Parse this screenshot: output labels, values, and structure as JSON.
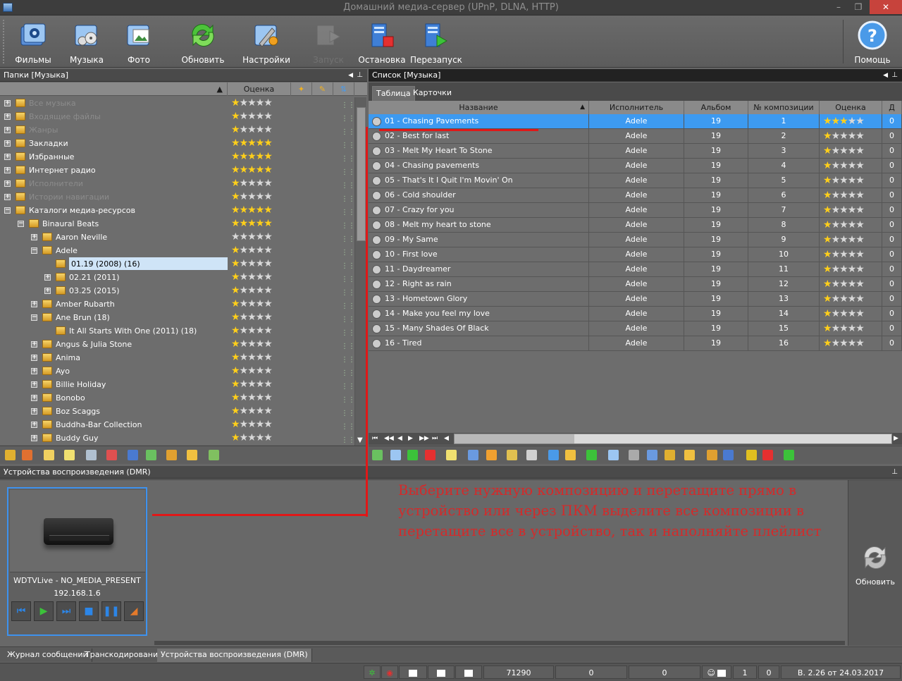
{
  "window": {
    "title": "Домашний медиа-сервер (UPnP, DLNA, HTTP)"
  },
  "toolbar": {
    "buttons": [
      {
        "label": "Фильмы"
      },
      {
        "label": "Музыка"
      },
      {
        "label": "Фото"
      },
      {
        "label": "Обновить"
      },
      {
        "label": "Настройки"
      },
      {
        "label": "Запуск",
        "disabled": true
      },
      {
        "label": "Остановка"
      },
      {
        "label": "Перезапуск"
      }
    ],
    "help_label": "Помощь"
  },
  "left_panel": {
    "title": "Папки [Музыка]",
    "column_rating": "Оценка",
    "tree": [
      {
        "label": "Все музыка",
        "dim": true,
        "rating": 1,
        "level": 0,
        "exp": "+"
      },
      {
        "label": "Входящие файлы",
        "dim": true,
        "rating": 1,
        "level": 0,
        "exp": "+"
      },
      {
        "label": "Жанры",
        "dim": true,
        "rating": 1,
        "level": 0,
        "exp": "+"
      },
      {
        "label": "Закладки",
        "rating": 5,
        "level": 0,
        "exp": "+"
      },
      {
        "label": "Избранные",
        "rating": 5,
        "level": 0,
        "exp": "+"
      },
      {
        "label": "Интернет радио",
        "rating": 5,
        "level": 0,
        "exp": "+"
      },
      {
        "label": "Исполнители",
        "dim": true,
        "rating": 1,
        "level": 0,
        "exp": "+"
      },
      {
        "label": "Истории навигации",
        "dim": true,
        "rating": 1,
        "level": 0,
        "exp": "+"
      },
      {
        "label": "Каталоги медиа-ресурсов",
        "rating": 5,
        "level": 0,
        "exp": "−"
      },
      {
        "label": "Binaural Beats",
        "rating": 5,
        "level": 1,
        "exp": "−"
      },
      {
        "label": "Aaron Neville",
        "rating": 0,
        "level": 2,
        "exp": "+"
      },
      {
        "label": "Adele",
        "rating": 1,
        "level": 2,
        "exp": "−"
      },
      {
        "label": "01.19 (2008) (16)",
        "rating": 1,
        "level": 3,
        "exp": "",
        "selected": true
      },
      {
        "label": "02.21 (2011)",
        "rating": 1,
        "level": 3,
        "exp": "+"
      },
      {
        "label": "03.25 (2015)",
        "rating": 1,
        "level": 3,
        "exp": "+"
      },
      {
        "label": "Amber Rubarth",
        "rating": 1,
        "level": 2,
        "exp": "+"
      },
      {
        "label": "Ane Brun (18)",
        "rating": 1,
        "level": 2,
        "exp": "−"
      },
      {
        "label": "It All Starts With One (2011) (18)",
        "rating": 1,
        "level": 3,
        "exp": ""
      },
      {
        "label": "Angus & Julia Stone",
        "rating": 1,
        "level": 2,
        "exp": "+"
      },
      {
        "label": "Anima",
        "rating": 1,
        "level": 2,
        "exp": "+"
      },
      {
        "label": "Ayo",
        "rating": 1,
        "level": 2,
        "exp": "+"
      },
      {
        "label": "Billie Holiday",
        "rating": 1,
        "level": 2,
        "exp": "+"
      },
      {
        "label": "Bonobo",
        "rating": 1,
        "level": 2,
        "exp": "+"
      },
      {
        "label": "Boz Scaggs",
        "rating": 1,
        "level": 2,
        "exp": "+"
      },
      {
        "label": "Buddha-Bar Collection",
        "rating": 1,
        "level": 2,
        "exp": "+"
      },
      {
        "label": "Buddy Guy",
        "rating": 1,
        "level": 2,
        "exp": "+"
      }
    ]
  },
  "right_panel": {
    "title": "Список [Музыка]",
    "tabs": [
      "Таблица",
      "Карточки"
    ],
    "columns": [
      "Название",
      "Исполнитель",
      "Альбом",
      "№ композиции",
      "Оценка",
      "Д"
    ],
    "rows": [
      {
        "name": "01 - Chasing Pavements",
        "artist": "Adele",
        "album": "19",
        "num": "1",
        "rating": 3,
        "d": "0"
      },
      {
        "name": "02 - Best for last",
        "artist": "Adele",
        "album": "19",
        "num": "2",
        "rating": 1,
        "d": "0"
      },
      {
        "name": "03 - Melt My Heart To Stone",
        "artist": "Adele",
        "album": "19",
        "num": "3",
        "rating": 1,
        "d": "0"
      },
      {
        "name": "04 - Chasing pavements",
        "artist": "Adele",
        "album": "19",
        "num": "4",
        "rating": 1,
        "d": "0"
      },
      {
        "name": "05 - That's It I Quit I'm Movin' On",
        "artist": "Adele",
        "album": "19",
        "num": "5",
        "rating": 1,
        "d": "0"
      },
      {
        "name": "06 - Cold shoulder",
        "artist": "Adele",
        "album": "19",
        "num": "6",
        "rating": 1,
        "d": "0"
      },
      {
        "name": "07 - Crazy for you",
        "artist": "Adele",
        "album": "19",
        "num": "7",
        "rating": 1,
        "d": "0"
      },
      {
        "name": "08 - Melt my heart to stone",
        "artist": "Adele",
        "album": "19",
        "num": "8",
        "rating": 1,
        "d": "0"
      },
      {
        "name": "09 - My Same",
        "artist": "Adele",
        "album": "19",
        "num": "9",
        "rating": 1,
        "d": "0"
      },
      {
        "name": "10 - First love",
        "artist": "Adele",
        "album": "19",
        "num": "10",
        "rating": 1,
        "d": "0"
      },
      {
        "name": "11 - Daydreamer",
        "artist": "Adele",
        "album": "19",
        "num": "11",
        "rating": 1,
        "d": "0"
      },
      {
        "name": "12 - Right as rain",
        "artist": "Adele",
        "album": "19",
        "num": "12",
        "rating": 1,
        "d": "0"
      },
      {
        "name": "13 - Hometown Glory",
        "artist": "Adele",
        "album": "19",
        "num": "13",
        "rating": 1,
        "d": "0"
      },
      {
        "name": "14 - Make you feel my love",
        "artist": "Adele",
        "album": "19",
        "num": "14",
        "rating": 1,
        "d": "0"
      },
      {
        "name": "15 - Many Shades Of Black",
        "artist": "Adele",
        "album": "19",
        "num": "15",
        "rating": 1,
        "d": "0"
      },
      {
        "name": "16 - Tired",
        "artist": "Adele",
        "album": "19",
        "num": "16",
        "rating": 1,
        "d": "0"
      }
    ]
  },
  "devices": {
    "title": "Устройства воспроизведения (DMR)",
    "device_name": "WDTVLive - NO_MEDIA_PRESENT",
    "device_ip": "192.168.1.6",
    "hint": "Выберите нужную композицию и перетащите прямо в устройство или через ПКМ выделите все композиции в перетащите все в устройство, так и наполняйте плейлист",
    "refresh_label": "Обновить"
  },
  "bottom_tabs": [
    "Журнал сообщений",
    "Транскодирование",
    "Устройства воспроизведения (DMR)"
  ],
  "status": {
    "count": "71290",
    "v1": "0",
    "v2": "0",
    "v3": "1",
    "v4": "0",
    "version": "В. 2.26 от 24.03.2017"
  },
  "colors": {
    "selection": "#3d9af0",
    "annotation": "#e01818",
    "star_on": "#ffcf1a"
  }
}
